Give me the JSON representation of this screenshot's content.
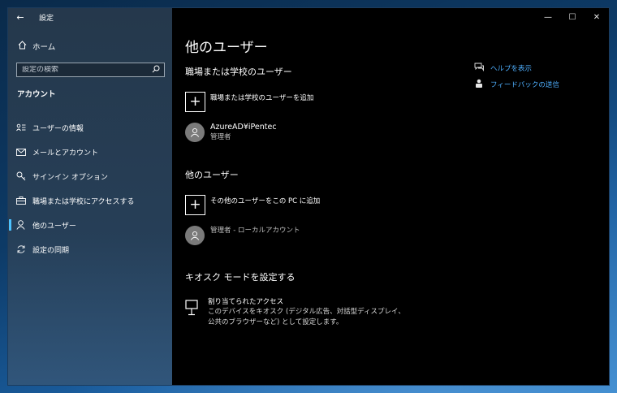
{
  "app": {
    "title": "設定",
    "back_glyph": "←"
  },
  "window_controls": {
    "minimize": "—",
    "maximize": "☐",
    "close": "✕"
  },
  "sidebar": {
    "home": {
      "label": "ホーム",
      "icon": "home-icon"
    },
    "search": {
      "placeholder": "設定の検索",
      "value": "",
      "icon": "search-icon"
    },
    "section_title": "アカウント",
    "items": [
      {
        "label": "ユーザーの情報",
        "icon": "user-info-icon",
        "glyph": "ꓤ≡",
        "active": false
      },
      {
        "label": "メールとアカウント",
        "icon": "mail-icon",
        "glyph": "✉",
        "active": false
      },
      {
        "label": "サインイン オプション",
        "icon": "key-icon",
        "glyph": "⚲",
        "active": false
      },
      {
        "label": "職場または学校にアクセスする",
        "icon": "briefcase-icon",
        "glyph": "💼",
        "active": false
      },
      {
        "label": "他のユーザー",
        "icon": "person-icon",
        "glyph": "⚇",
        "active": true
      },
      {
        "label": "設定の同期",
        "icon": "sync-icon",
        "glyph": "⟳",
        "active": false
      }
    ]
  },
  "main": {
    "page_title": "他のユーザー",
    "work_school": {
      "title": "職場または学校のユーザー",
      "add_label": "職場または学校のユーザーを追加",
      "user": {
        "name": "AzureAD¥iPentec",
        "role": "管理者"
      }
    },
    "other_users": {
      "title": "他のユーザー",
      "add_label": "その他のユーザーをこの PC に追加",
      "user": {
        "name": "",
        "role": "管理者 - ローカルアカウント"
      }
    },
    "kiosk": {
      "title": "キオスク モードを設定する",
      "item_title": "割り当てられたアクセス",
      "item_desc": "このデバイスをキオスク (デジタル広告、対話型ディスプレイ、公共のブラウザーなど) として設定します。"
    },
    "help_links": [
      {
        "label": "ヘルプを表示",
        "icon": "help-chat-icon"
      },
      {
        "label": "フィードバックの送信",
        "icon": "feedback-icon"
      }
    ]
  },
  "colors": {
    "accent": "#4cc2ff",
    "link": "#4fb0ff",
    "background": "#000000"
  }
}
